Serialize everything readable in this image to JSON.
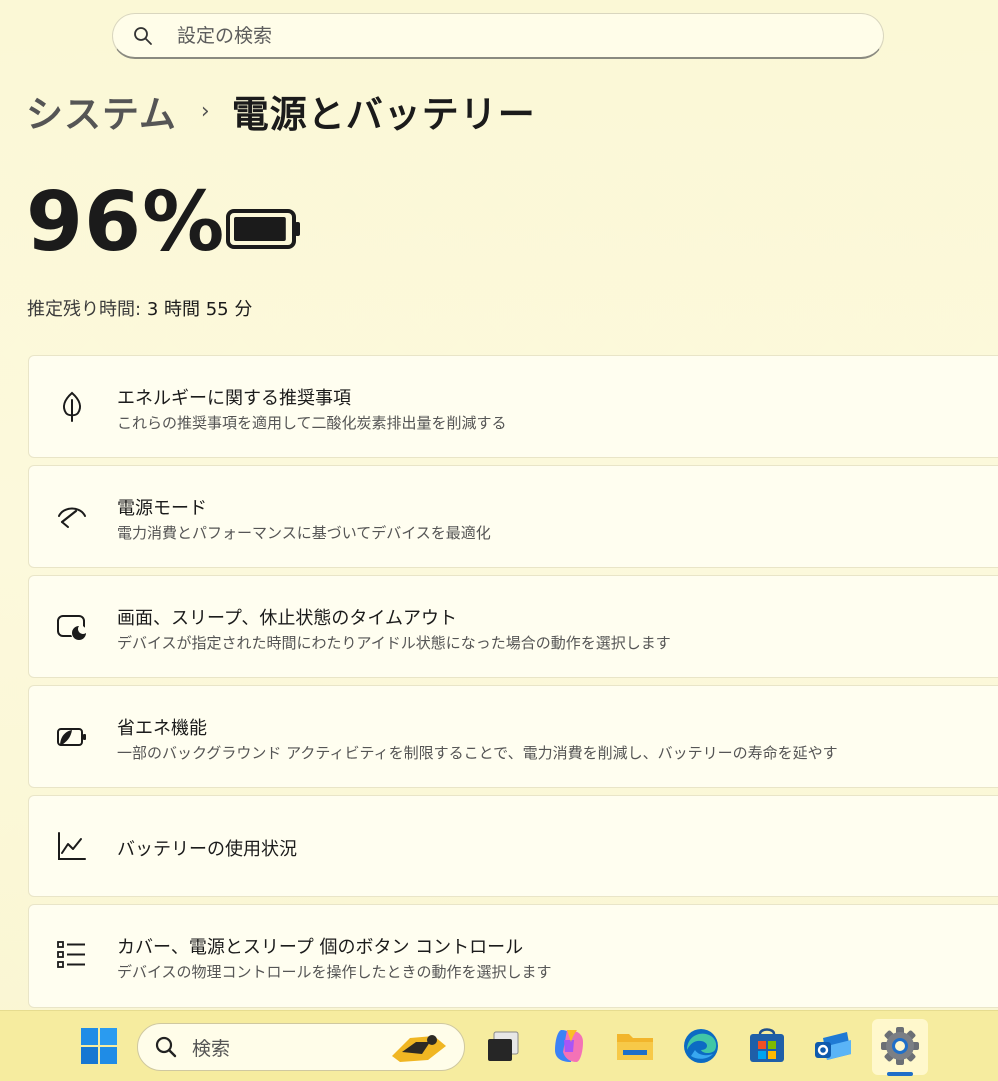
{
  "search": {
    "placeholder": "設定の検索"
  },
  "breadcrumb": {
    "parent": "システム",
    "separator": "›",
    "current": "電源とバッテリー"
  },
  "battery": {
    "percent_text": "96%",
    "level": 0.96,
    "remaining_label": "推定残り時間:",
    "remaining_value": "3 時間 55 分"
  },
  "items": [
    {
      "title": "エネルギーに関する推奨事項",
      "description": "これらの推奨事項を適用して二酸化炭素排出量を削減する",
      "icon": "leaf-icon"
    },
    {
      "title": "電源モード",
      "description": "電力消費とパフォーマンスに基づいてデバイスを最適化",
      "icon": "gauge-icon"
    },
    {
      "title": "画面、スリープ、休止状態のタイムアウト",
      "description": "デバイスが指定された時間にわたりアイドル状態になった場合の動作を選択します",
      "icon": "screen-sleep-icon"
    },
    {
      "title": "省エネ機能",
      "description": "一部のバックグラウンド アクティビティを制限することで、電力消費を削減し、バッテリーの寿命を延やす",
      "icon": "battery-saver-icon"
    },
    {
      "title": "バッテリーの使用状況",
      "description": "",
      "icon": "chart-line-icon"
    },
    {
      "title": "カバー、電源とスリープ 個のボタン コントロール",
      "description": "デバイスの物理コントロールを操作したときの動作を選択します",
      "icon": "list-icon"
    }
  ],
  "taskbar": {
    "search_label": "検索",
    "apps": [
      "windows-start-icon",
      "task-view-icon",
      "copilot-icon",
      "file-explorer-icon",
      "edge-icon",
      "store-icon",
      "outlook-icon",
      "settings-icon"
    ]
  },
  "colors": {
    "accent": "#1f6fc8",
    "taskbar": "#f6ec9f",
    "background": "#fbf8d6"
  }
}
